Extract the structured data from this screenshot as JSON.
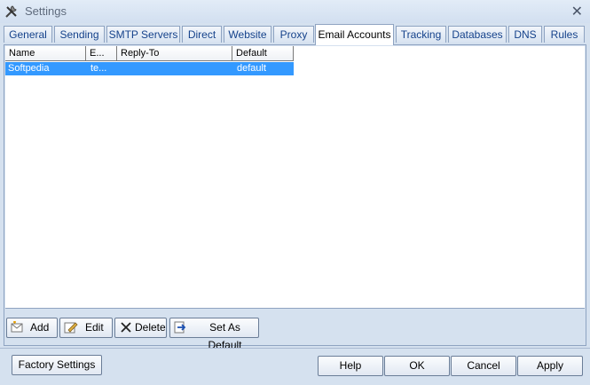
{
  "window": {
    "title": "Settings"
  },
  "tabs": [
    {
      "label": "General"
    },
    {
      "label": "Sending"
    },
    {
      "label": "SMTP Servers"
    },
    {
      "label": "Direct"
    },
    {
      "label": "Website"
    },
    {
      "label": "Proxy"
    },
    {
      "label": "Email Accounts",
      "active": true
    },
    {
      "label": "Tracking"
    },
    {
      "label": "Databases"
    },
    {
      "label": "DNS"
    },
    {
      "label": "Rules"
    }
  ],
  "grid": {
    "columns": [
      "Name",
      "E...",
      "Reply-To",
      "Default"
    ],
    "rows": [
      {
        "name": "Softpedia",
        "email": "te...",
        "reply_to": "",
        "default": "default",
        "selected": true
      }
    ]
  },
  "actions": {
    "add": "Add",
    "edit": "Edit",
    "delete": "Delete",
    "set_default": "Set As Default"
  },
  "footer": {
    "factory": "Factory Settings",
    "help": "Help",
    "ok": "OK",
    "cancel": "Cancel",
    "apply": "Apply"
  },
  "colors": {
    "selection": "#3399ff",
    "tab_text": "#15428b",
    "chrome": "#d5e1ef"
  }
}
